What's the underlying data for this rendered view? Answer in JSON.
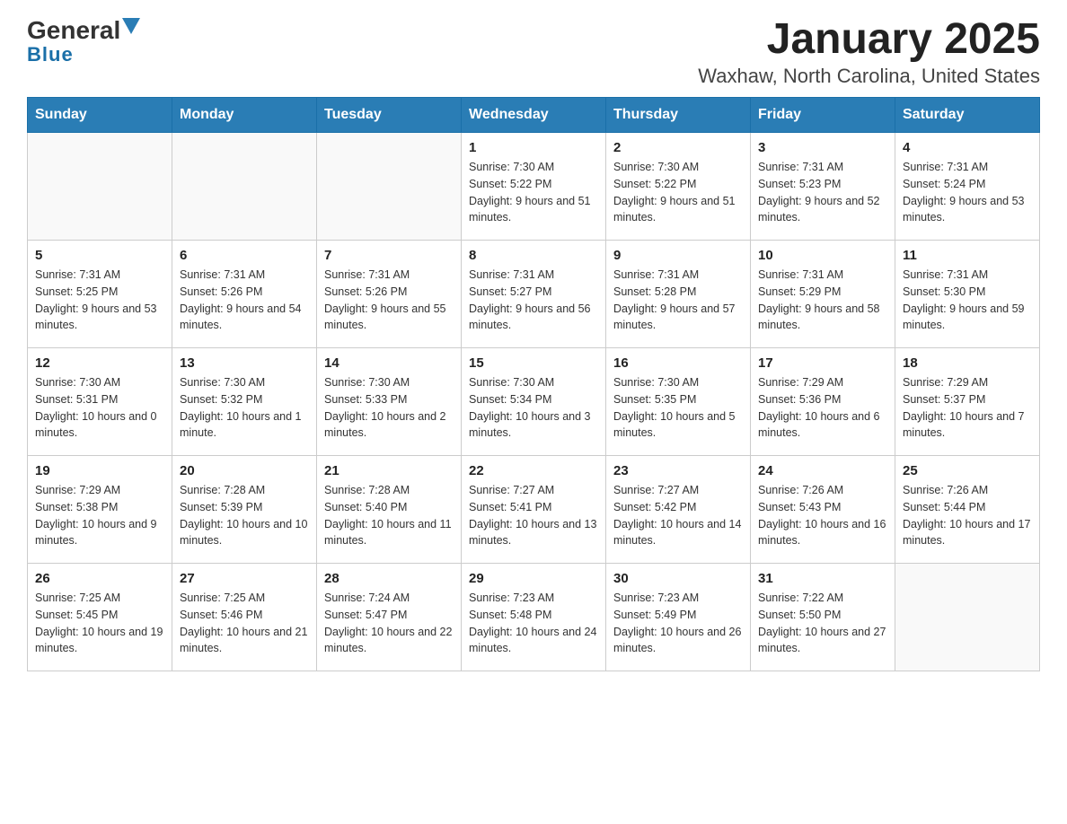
{
  "logo": {
    "text1": "General",
    "text2": "Blue"
  },
  "title": "January 2025",
  "subtitle": "Waxhaw, North Carolina, United States",
  "days_of_week": [
    "Sunday",
    "Monday",
    "Tuesday",
    "Wednesday",
    "Thursday",
    "Friday",
    "Saturday"
  ],
  "weeks": [
    [
      {
        "day": "",
        "info": ""
      },
      {
        "day": "",
        "info": ""
      },
      {
        "day": "",
        "info": ""
      },
      {
        "day": "1",
        "info": "Sunrise: 7:30 AM\nSunset: 5:22 PM\nDaylight: 9 hours and 51 minutes."
      },
      {
        "day": "2",
        "info": "Sunrise: 7:30 AM\nSunset: 5:22 PM\nDaylight: 9 hours and 51 minutes."
      },
      {
        "day": "3",
        "info": "Sunrise: 7:31 AM\nSunset: 5:23 PM\nDaylight: 9 hours and 52 minutes."
      },
      {
        "day": "4",
        "info": "Sunrise: 7:31 AM\nSunset: 5:24 PM\nDaylight: 9 hours and 53 minutes."
      }
    ],
    [
      {
        "day": "5",
        "info": "Sunrise: 7:31 AM\nSunset: 5:25 PM\nDaylight: 9 hours and 53 minutes."
      },
      {
        "day": "6",
        "info": "Sunrise: 7:31 AM\nSunset: 5:26 PM\nDaylight: 9 hours and 54 minutes."
      },
      {
        "day": "7",
        "info": "Sunrise: 7:31 AM\nSunset: 5:26 PM\nDaylight: 9 hours and 55 minutes."
      },
      {
        "day": "8",
        "info": "Sunrise: 7:31 AM\nSunset: 5:27 PM\nDaylight: 9 hours and 56 minutes."
      },
      {
        "day": "9",
        "info": "Sunrise: 7:31 AM\nSunset: 5:28 PM\nDaylight: 9 hours and 57 minutes."
      },
      {
        "day": "10",
        "info": "Sunrise: 7:31 AM\nSunset: 5:29 PM\nDaylight: 9 hours and 58 minutes."
      },
      {
        "day": "11",
        "info": "Sunrise: 7:31 AM\nSunset: 5:30 PM\nDaylight: 9 hours and 59 minutes."
      }
    ],
    [
      {
        "day": "12",
        "info": "Sunrise: 7:30 AM\nSunset: 5:31 PM\nDaylight: 10 hours and 0 minutes."
      },
      {
        "day": "13",
        "info": "Sunrise: 7:30 AM\nSunset: 5:32 PM\nDaylight: 10 hours and 1 minute."
      },
      {
        "day": "14",
        "info": "Sunrise: 7:30 AM\nSunset: 5:33 PM\nDaylight: 10 hours and 2 minutes."
      },
      {
        "day": "15",
        "info": "Sunrise: 7:30 AM\nSunset: 5:34 PM\nDaylight: 10 hours and 3 minutes."
      },
      {
        "day": "16",
        "info": "Sunrise: 7:30 AM\nSunset: 5:35 PM\nDaylight: 10 hours and 5 minutes."
      },
      {
        "day": "17",
        "info": "Sunrise: 7:29 AM\nSunset: 5:36 PM\nDaylight: 10 hours and 6 minutes."
      },
      {
        "day": "18",
        "info": "Sunrise: 7:29 AM\nSunset: 5:37 PM\nDaylight: 10 hours and 7 minutes."
      }
    ],
    [
      {
        "day": "19",
        "info": "Sunrise: 7:29 AM\nSunset: 5:38 PM\nDaylight: 10 hours and 9 minutes."
      },
      {
        "day": "20",
        "info": "Sunrise: 7:28 AM\nSunset: 5:39 PM\nDaylight: 10 hours and 10 minutes."
      },
      {
        "day": "21",
        "info": "Sunrise: 7:28 AM\nSunset: 5:40 PM\nDaylight: 10 hours and 11 minutes."
      },
      {
        "day": "22",
        "info": "Sunrise: 7:27 AM\nSunset: 5:41 PM\nDaylight: 10 hours and 13 minutes."
      },
      {
        "day": "23",
        "info": "Sunrise: 7:27 AM\nSunset: 5:42 PM\nDaylight: 10 hours and 14 minutes."
      },
      {
        "day": "24",
        "info": "Sunrise: 7:26 AM\nSunset: 5:43 PM\nDaylight: 10 hours and 16 minutes."
      },
      {
        "day": "25",
        "info": "Sunrise: 7:26 AM\nSunset: 5:44 PM\nDaylight: 10 hours and 17 minutes."
      }
    ],
    [
      {
        "day": "26",
        "info": "Sunrise: 7:25 AM\nSunset: 5:45 PM\nDaylight: 10 hours and 19 minutes."
      },
      {
        "day": "27",
        "info": "Sunrise: 7:25 AM\nSunset: 5:46 PM\nDaylight: 10 hours and 21 minutes."
      },
      {
        "day": "28",
        "info": "Sunrise: 7:24 AM\nSunset: 5:47 PM\nDaylight: 10 hours and 22 minutes."
      },
      {
        "day": "29",
        "info": "Sunrise: 7:23 AM\nSunset: 5:48 PM\nDaylight: 10 hours and 24 minutes."
      },
      {
        "day": "30",
        "info": "Sunrise: 7:23 AM\nSunset: 5:49 PM\nDaylight: 10 hours and 26 minutes."
      },
      {
        "day": "31",
        "info": "Sunrise: 7:22 AM\nSunset: 5:50 PM\nDaylight: 10 hours and 27 minutes."
      },
      {
        "day": "",
        "info": ""
      }
    ]
  ]
}
